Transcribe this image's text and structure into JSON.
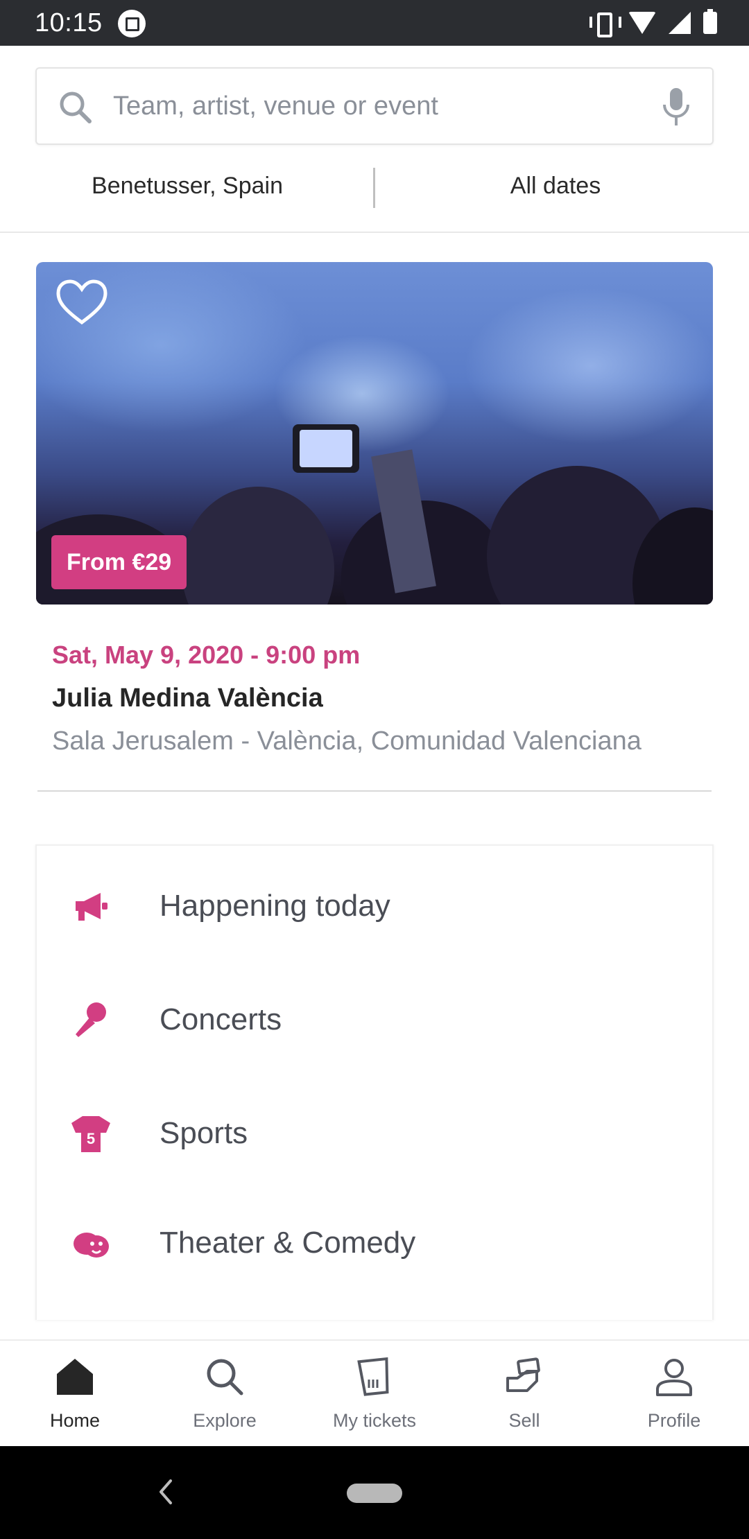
{
  "status_bar": {
    "time": "10:15"
  },
  "search": {
    "placeholder": "Team, artist, venue or event"
  },
  "filters": {
    "location": "Benetusser, Spain",
    "dates": "All dates"
  },
  "featured_event": {
    "price": "From €29",
    "date": "Sat, May 9, 2020 - 9:00 pm",
    "title": "Julia Medina València",
    "venue": "Sala Jerusalem - València, Comunidad Valenciana"
  },
  "categories": [
    {
      "label": "Happening today",
      "icon": "megaphone-icon"
    },
    {
      "label": "Concerts",
      "icon": "microphone-icon"
    },
    {
      "label": "Sports",
      "icon": "jersey-icon"
    },
    {
      "label": "Theater & Comedy",
      "icon": "theater-masks-icon"
    }
  ],
  "bottom_nav": [
    {
      "label": "Home",
      "icon": "home-icon",
      "active": true
    },
    {
      "label": "Explore",
      "icon": "search-icon"
    },
    {
      "label": "My tickets",
      "icon": "ticket-icon"
    },
    {
      "label": "Sell",
      "icon": "sell-hand-icon"
    },
    {
      "label": "Profile",
      "icon": "profile-icon"
    }
  ],
  "colors": {
    "accent": "#d23e82",
    "accent_text": "#c9427f",
    "muted": "#8a8f98",
    "status_bar": "#2b2d31"
  }
}
